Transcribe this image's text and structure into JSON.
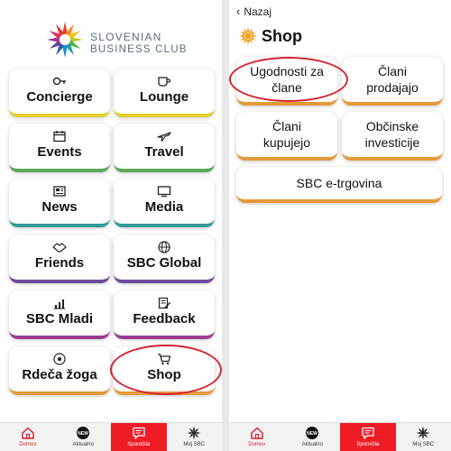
{
  "left": {
    "logo": {
      "line1": "SLOVENIAN",
      "line2": "BUSINESS CLUB"
    },
    "tiles": [
      {
        "label": "Concierge",
        "icon": "key-icon"
      },
      {
        "label": "Lounge",
        "icon": "coffee-cup-icon"
      },
      {
        "label": "Events",
        "icon": "calendar-icon"
      },
      {
        "label": "Travel",
        "icon": "airplane-icon"
      },
      {
        "label": "News",
        "icon": "newspaper-icon"
      },
      {
        "label": "Media",
        "icon": "tv-icon"
      },
      {
        "label": "Friends",
        "icon": "handshake-icon"
      },
      {
        "label": "SBC Global",
        "icon": "globe-icon"
      },
      {
        "label": "SBC Mladi",
        "icon": "growth-chart-icon"
      },
      {
        "label": "Feedback",
        "icon": "form-edit-icon"
      },
      {
        "label": "Rdeča žoga",
        "icon": "soccer-ball-icon"
      },
      {
        "label": "Shop",
        "icon": "shopping-cart-icon"
      }
    ],
    "nav": [
      {
        "label": "Domov",
        "icon": "home-icon"
      },
      {
        "label": "Aktualno",
        "icon": "new-badge-icon",
        "badge": "NEW"
      },
      {
        "label": "Sporočila",
        "icon": "message-icon"
      },
      {
        "label": "Moj SBC",
        "icon": "sbc-sun-icon"
      }
    ]
  },
  "right": {
    "back_label": "Nazaj",
    "title": "Shop",
    "tiles": [
      {
        "line1": "Ugodnosti za",
        "line2": "člane"
      },
      {
        "line1": "Člani",
        "line2": "prodajajo"
      },
      {
        "line1": "Člani",
        "line2": "kupujejo"
      },
      {
        "line1": "Občinske",
        "line2": "investicije"
      },
      {
        "line1": "SBC e-trgovina",
        "line2": ""
      }
    ],
    "nav": [
      {
        "label": "Domov"
      },
      {
        "label": "Aktualno",
        "badge": "NEW"
      },
      {
        "label": "Sporočila"
      },
      {
        "label": "Moj SBC"
      }
    ]
  },
  "colors": {
    "accent_red": "#ee1c25",
    "highlight_ring": "#d42430",
    "shop_tile_border": "#e49a3a"
  }
}
